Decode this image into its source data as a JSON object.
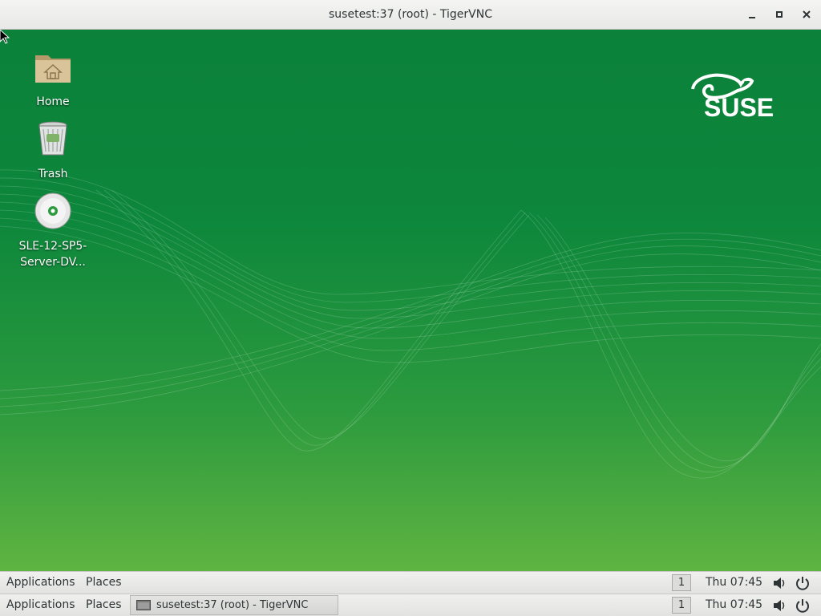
{
  "window": {
    "title": "susetest:37 (root) - TigerVNC"
  },
  "desktop": {
    "icons": [
      {
        "label": "Home",
        "icon": "home-folder-icon"
      },
      {
        "label": "Trash",
        "icon": "trash-icon"
      },
      {
        "label": "SLE-12-SP5-Server-DV...",
        "icon": "dvd-icon"
      }
    ],
    "logo": "SUSE"
  },
  "top_panel": {
    "applications": "Applications",
    "places": "Places",
    "workspace": "1",
    "clock": "Thu 07:45"
  },
  "bottom_panel": {
    "applications": "Applications",
    "places": "Places",
    "task": "susetest:37 (root) - TigerVNC",
    "workspace": "1",
    "clock": "Thu 07:45"
  },
  "colors": {
    "desktop_top": "#0b8139",
    "desktop_bottom": "#5fb441",
    "panel": "#e8e8e7"
  }
}
